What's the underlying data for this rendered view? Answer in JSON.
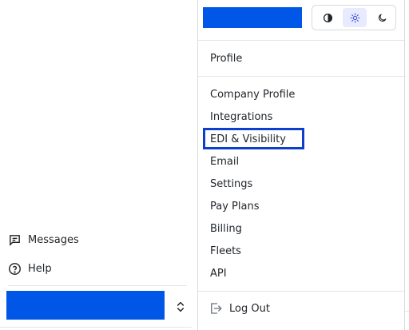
{
  "colors": {
    "accent": "#0057e7",
    "focus": "#0b3fcc"
  },
  "sidebar": {
    "messages_label": "Messages",
    "help_label": "Help",
    "messages_icon": "message-icon",
    "help_icon": "help-circle-icon",
    "user_menu_icon": "chevron-up-down-icon"
  },
  "menu": {
    "theme_icons": [
      "contrast-icon",
      "sun-icon",
      "moon-icon"
    ],
    "profile": "Profile",
    "items": [
      "Company Profile",
      "Integrations",
      "EDI & Visibility",
      "Email",
      "Settings",
      "Pay Plans",
      "Billing",
      "Fleets",
      "API"
    ],
    "logout": "Log Out"
  }
}
